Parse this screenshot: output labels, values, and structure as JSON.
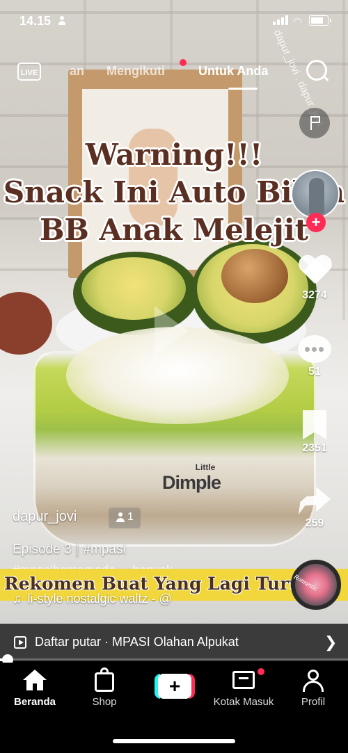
{
  "status_bar": {
    "time": "14.15"
  },
  "watermark": "dapur_jovi . dapur_jovi",
  "top_nav": {
    "live_label": "LIVE",
    "tabs": [
      {
        "label": "an",
        "active": false
      },
      {
        "label": "Mengikuti",
        "active": false
      },
      {
        "label": "Untuk Anda",
        "active": true
      }
    ]
  },
  "video": {
    "headline": [
      "Warning!!!",
      "Snack Ini Auto Bikin",
      "BB Anak Melejit"
    ],
    "product_brand_small": "Little",
    "product_brand": "Dimple",
    "caption_banner": "Rekomen Buat Yang Lagi Turun"
  },
  "side_actions": {
    "likes": "3274",
    "comments": "51",
    "saves": "2351",
    "shares": "259",
    "follow_symbol": "+"
  },
  "post": {
    "username": "dapur_jovi",
    "friends_count": "1",
    "episode": "Episode 3",
    "hashtag1": "#mpasi",
    "hashtag2": "#mpasihomemade",
    "more": "banyak",
    "music": "li-style nostalgic waltz - @",
    "disc_label": "Romantic"
  },
  "playlist": {
    "text": "Daftar putar · MPASI Olahan Alpukat"
  },
  "progress_fraction": 0.02,
  "bottom_nav": {
    "home": "Beranda",
    "shop": "Shop",
    "create_symbol": "+",
    "inbox": "Kotak Masuk",
    "profile": "Profil"
  },
  "colors": {
    "accent": "#fe2c55",
    "cyan": "#25f4ee",
    "banner": "#f2d73c",
    "headline": "#5a2f22"
  }
}
